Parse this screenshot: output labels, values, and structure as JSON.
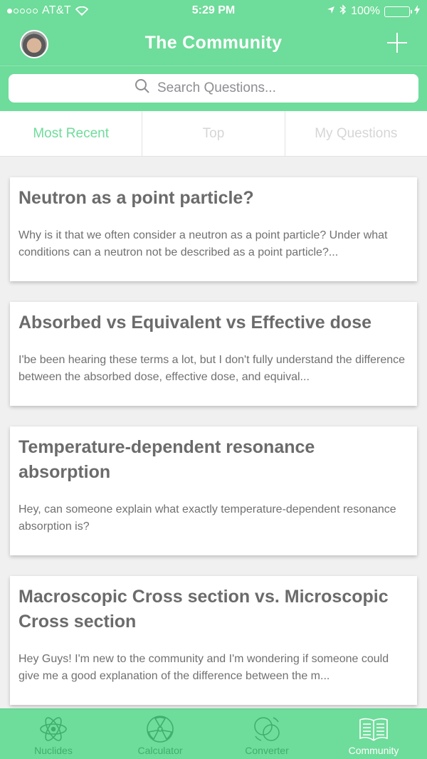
{
  "status_bar": {
    "carrier": "AT&T",
    "time": "5:29 PM",
    "battery": "100%",
    "signal_icon": "signal-dots-icon",
    "wifi_icon": "wifi-icon",
    "location_icon": "location-arrow-icon",
    "bluetooth_icon": "bluetooth-icon",
    "charging_icon": "charging-bolt-icon"
  },
  "navbar": {
    "title": "The Community",
    "add_icon": "plus-icon"
  },
  "search": {
    "placeholder": "Search Questions..."
  },
  "tabs": [
    {
      "label": "Most Recent",
      "active": true
    },
    {
      "label": "Top",
      "active": false
    },
    {
      "label": "My Questions",
      "active": false
    }
  ],
  "questions": [
    {
      "title": "Neutron as a point particle?",
      "body": "Why is it that we often consider a neutron as a point particle? Under what conditions can a neutron not be described as a point particle?..."
    },
    {
      "title": "Absorbed vs Equivalent vs Effective dose",
      "body": "I'be been hearing these terms a lot, but I don't fully understand the difference between the absorbed dose, effective dose, and equival..."
    },
    {
      "title": "Temperature-dependent resonance absorption",
      "body": "Hey, can someone explain what exactly temperature-dependent resonance absorption is?"
    },
    {
      "title": "Macroscopic Cross section vs. Microscopic Cross section",
      "body": "Hey Guys! I'm new to the community and I'm wondering if someone could give me a good explanation of the difference between the m..."
    }
  ],
  "tabbar": [
    {
      "label": "Nuclides",
      "icon": "atom-icon",
      "active": false
    },
    {
      "label": "Calculator",
      "icon": "radiation-icon",
      "active": false
    },
    {
      "label": "Converter",
      "icon": "unit-converter-icon",
      "active": false
    },
    {
      "label": "Community",
      "icon": "book-icon",
      "active": true
    }
  ],
  "colors": {
    "accent": "#6edc9a",
    "inactive_tab_text": "#d6d6d6",
    "card_title": "#6b6b6b"
  }
}
